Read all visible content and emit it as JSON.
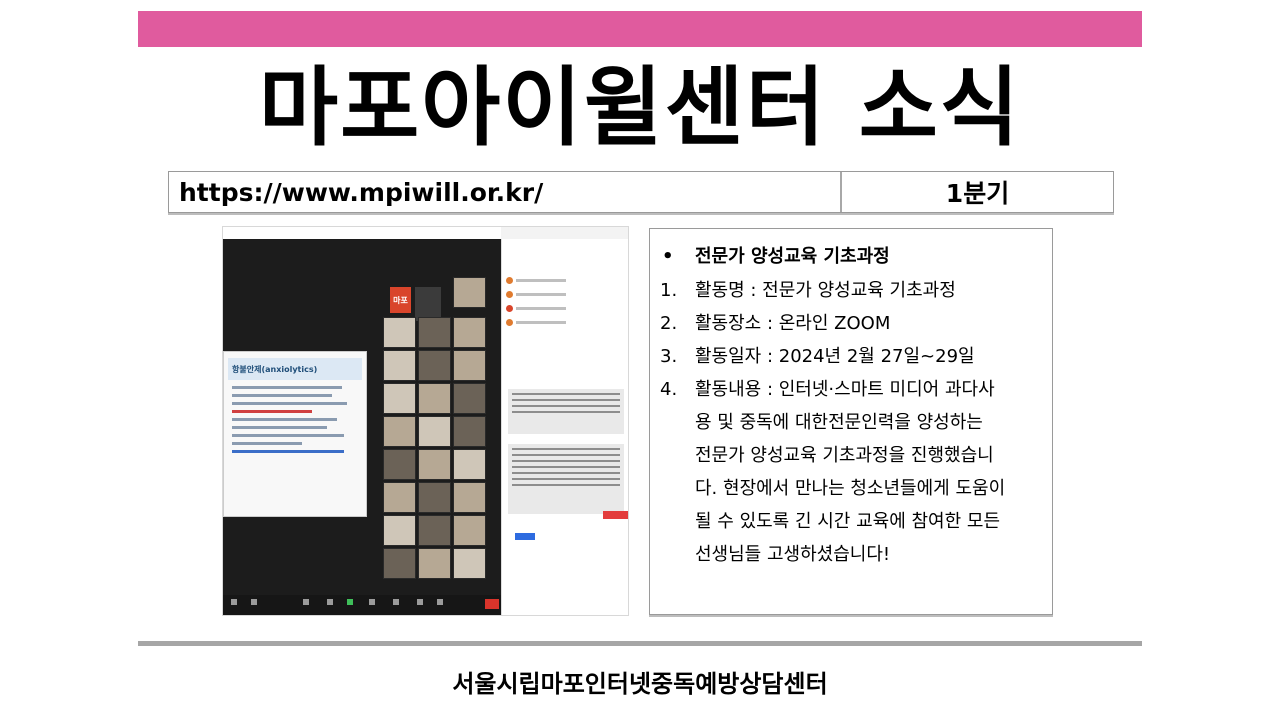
{
  "header": {
    "title": "마포아이윌센터 소식",
    "url": "https://www.mpiwill.or.kr/",
    "quarter": "1분기"
  },
  "screenshot": {
    "slide_title": "항불안제(anxiolytics)",
    "orange_tile_label": "마포"
  },
  "activity": {
    "bullet": "전문가 양성교육 기초과정",
    "items": [
      {
        "num": "1.",
        "text": "활동명 : 전문가 양성교육 기초과정"
      },
      {
        "num": "2.",
        "text": "활동장소 : 온라인 ZOOM"
      },
      {
        "num": "3.",
        "text": "활동일자 : 2024년 2월 27일~29일"
      },
      {
        "num": "4.",
        "text": "활동내용 : 인터넷·스마트 미디어 과다사"
      }
    ],
    "continuation": [
      "용 및 중독에 대한전문인력을 양성하는",
      "전문가 양성교육 기초과정을 진행했습니",
      "다. 현장에서 만나는 청소년들에게 도움이",
      "될 수 있도록 긴 시간 교육에 참여한 모든",
      "선생님들 고생하셨습니다!"
    ]
  },
  "footer": {
    "center_name": "서울시립마포인터넷중독예방상담센터"
  },
  "colors": {
    "top_bar": "#e05b9e",
    "bottom_bar": "#a6a6a6"
  }
}
